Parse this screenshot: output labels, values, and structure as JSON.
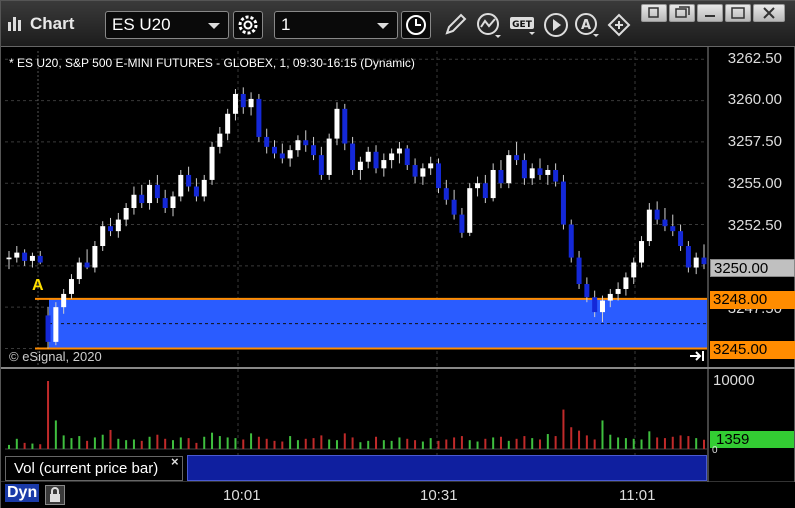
{
  "toolbar": {
    "app_title": "Chart",
    "symbol": "ES U20",
    "interval": "1",
    "icons": [
      "settings-gear-icon",
      "clock-icon",
      "pencil-icon",
      "indicator-icon",
      "get-icon",
      "play-icon",
      "auto-icon",
      "share-icon"
    ]
  },
  "chart": {
    "title": "* ES U20, S&P 500 E-MINI FUTURES - GLOBEX, 1, 09:30-16:15 (Dynamic)",
    "copyright": "© eSignal, 2020",
    "marker": "A",
    "price_axis": [
      "3262.50",
      "3260.00",
      "3257.50",
      "3255.00",
      "3252.50",
      "3250.00",
      "3247.50",
      "3245.00"
    ],
    "last_price": "3250.00",
    "zone_upper": "3248.00",
    "zone_lower": "3245.00",
    "colors": {
      "up": "#ffffff",
      "down": "#1428d8",
      "zone": "#2a5cff",
      "zone_border": "#ff8c00"
    }
  },
  "volume": {
    "label": "Vol (current price bar)",
    "max_label": "10000",
    "current": "1359",
    "zero": "0"
  },
  "time_axis": [
    "10:01",
    "10:31",
    "11:01"
  ],
  "bottom": {
    "dyn": "Dyn"
  },
  "chart_data": {
    "type": "candlestick",
    "title": "* ES U20, S&P 500 E-MINI FUTURES - GLOBEX, 1, 09:30-16:15 (Dynamic)",
    "ylim": [
      3244,
      3263
    ],
    "yticks": [
      3262.5,
      3260.0,
      3257.5,
      3255.0,
      3252.5,
      3250.0,
      3247.5,
      3245.0
    ],
    "xticks": [
      "10:01",
      "10:31",
      "11:01"
    ],
    "zone": [
      3245.0,
      3248.0
    ],
    "candles": [
      [
        3250.4,
        3250.9,
        3249.8,
        3250.5
      ],
      [
        3250.5,
        3251.2,
        3250.2,
        3250.8
      ],
      [
        3250.8,
        3251.0,
        3250.0,
        3250.3
      ],
      [
        3250.3,
        3250.8,
        3249.9,
        3250.6
      ],
      [
        3250.6,
        3250.9,
        3250.1,
        3250.2
      ],
      [
        3247.0,
        3247.5,
        3245.0,
        3245.4
      ],
      [
        3245.4,
        3247.8,
        3245.2,
        3247.5
      ],
      [
        3247.5,
        3248.6,
        3247.1,
        3248.3
      ],
      [
        3248.3,
        3249.5,
        3248.0,
        3249.2
      ],
      [
        3249.2,
        3250.5,
        3248.9,
        3250.2
      ],
      [
        3250.2,
        3251.0,
        3249.8,
        3249.9
      ],
      [
        3249.9,
        3251.5,
        3249.6,
        3251.2
      ],
      [
        3251.2,
        3252.7,
        3250.9,
        3252.4
      ],
      [
        3252.4,
        3252.9,
        3251.8,
        3252.1
      ],
      [
        3252.1,
        3253.2,
        3251.7,
        3252.8
      ],
      [
        3252.8,
        3253.8,
        3252.4,
        3253.5
      ],
      [
        3253.5,
        3254.8,
        3253.1,
        3254.3
      ],
      [
        3254.3,
        3254.9,
        3253.5,
        3253.8
      ],
      [
        3253.8,
        3255.2,
        3253.4,
        3254.9
      ],
      [
        3254.9,
        3255.5,
        3253.8,
        3254.1
      ],
      [
        3254.1,
        3254.6,
        3253.2,
        3253.5
      ],
      [
        3253.5,
        3254.5,
        3253.0,
        3254.2
      ],
      [
        3254.2,
        3255.8,
        3253.9,
        3255.5
      ],
      [
        3255.5,
        3256.0,
        3254.5,
        3254.8
      ],
      [
        3254.8,
        3255.3,
        3253.9,
        3254.2
      ],
      [
        3254.2,
        3255.5,
        3253.9,
        3255.2
      ],
      [
        3255.2,
        3257.5,
        3254.9,
        3257.2
      ],
      [
        3257.2,
        3258.4,
        3256.8,
        3258.0
      ],
      [
        3258.0,
        3259.5,
        3257.6,
        3259.2
      ],
      [
        3259.2,
        3260.7,
        3258.8,
        3260.4
      ],
      [
        3260.4,
        3260.8,
        3259.2,
        3259.6
      ],
      [
        3259.6,
        3260.5,
        3259.1,
        3260.1
      ],
      [
        3260.1,
        3260.4,
        3257.5,
        3257.8
      ],
      [
        3257.8,
        3258.3,
        3256.8,
        3257.2
      ],
      [
        3257.2,
        3257.6,
        3256.5,
        3256.8
      ],
      [
        3256.8,
        3257.4,
        3256.2,
        3256.5
      ],
      [
        3256.5,
        3257.3,
        3256.0,
        3257.0
      ],
      [
        3257.0,
        3257.9,
        3256.6,
        3257.6
      ],
      [
        3257.6,
        3258.2,
        3256.9,
        3257.3
      ],
      [
        3257.3,
        3257.8,
        3256.4,
        3256.7
      ],
      [
        3256.7,
        3257.2,
        3255.2,
        3255.5
      ],
      [
        3255.5,
        3258.0,
        3255.2,
        3257.7
      ],
      [
        3257.7,
        3259.9,
        3257.3,
        3259.5
      ],
      [
        3259.5,
        3259.8,
        3257.0,
        3257.4
      ],
      [
        3257.4,
        3257.8,
        3255.5,
        3255.8
      ],
      [
        3255.8,
        3256.6,
        3255.2,
        3256.3
      ],
      [
        3256.3,
        3257.2,
        3255.9,
        3256.9
      ],
      [
        3256.9,
        3257.3,
        3255.6,
        3255.9
      ],
      [
        3255.9,
        3256.8,
        3255.4,
        3256.4
      ],
      [
        3256.4,
        3257.1,
        3255.9,
        3256.8
      ],
      [
        3256.8,
        3257.5,
        3256.2,
        3257.1
      ],
      [
        3257.1,
        3257.3,
        3255.8,
        3256.1
      ],
      [
        3256.1,
        3256.5,
        3255.0,
        3255.4
      ],
      [
        3255.4,
        3256.2,
        3254.9,
        3255.9
      ],
      [
        3255.9,
        3256.6,
        3255.5,
        3256.2
      ],
      [
        3256.2,
        3256.5,
        3254.4,
        3254.7
      ],
      [
        3254.7,
        3255.2,
        3253.7,
        3254.0
      ],
      [
        3254.0,
        3254.6,
        3252.8,
        3253.1
      ],
      [
        3253.1,
        3253.5,
        3251.7,
        3252.0
      ],
      [
        3252.0,
        3255.0,
        3251.8,
        3254.7
      ],
      [
        3254.7,
        3255.4,
        3254.2,
        3255.0
      ],
      [
        3255.0,
        3255.5,
        3253.8,
        3254.1
      ],
      [
        3254.1,
        3256.2,
        3253.9,
        3255.8
      ],
      [
        3255.8,
        3256.4,
        3254.7,
        3255.0
      ],
      [
        3255.0,
        3257.0,
        3254.7,
        3256.7
      ],
      [
        3256.7,
        3257.5,
        3256.1,
        3256.4
      ],
      [
        3256.4,
        3256.8,
        3254.9,
        3255.3
      ],
      [
        3255.3,
        3256.2,
        3254.9,
        3255.9
      ],
      [
        3255.9,
        3256.5,
        3255.2,
        3255.5
      ],
      [
        3255.5,
        3256.1,
        3254.9,
        3255.8
      ],
      [
        3255.8,
        3256.2,
        3254.8,
        3255.1
      ],
      [
        3255.1,
        3255.5,
        3252.2,
        3252.5
      ],
      [
        3252.5,
        3252.8,
        3250.2,
        3250.5
      ],
      [
        3250.5,
        3250.9,
        3248.6,
        3248.9
      ],
      [
        3248.9,
        3249.3,
        3247.8,
        3248.1
      ],
      [
        3248.1,
        3248.5,
        3246.9,
        3247.2
      ],
      [
        3247.2,
        3248.2,
        3246.6,
        3247.9
      ],
      [
        3247.9,
        3248.6,
        3247.5,
        3248.3
      ],
      [
        3248.3,
        3249.0,
        3247.9,
        3248.6
      ],
      [
        3248.6,
        3249.6,
        3248.2,
        3249.3
      ],
      [
        3249.3,
        3250.5,
        3248.9,
        3250.2
      ],
      [
        3250.2,
        3251.8,
        3249.9,
        3251.5
      ],
      [
        3251.5,
        3253.8,
        3251.2,
        3253.4
      ],
      [
        3253.4,
        3253.9,
        3252.5,
        3252.8
      ],
      [
        3252.8,
        3253.5,
        3252.1,
        3252.4
      ],
      [
        3252.4,
        3253.1,
        3251.8,
        3252.1
      ],
      [
        3252.1,
        3252.5,
        3250.9,
        3251.2
      ],
      [
        3251.2,
        3251.5,
        3249.6,
        3249.9
      ],
      [
        3249.9,
        3250.8,
        3249.5,
        3250.5
      ],
      [
        3250.5,
        3251.3,
        3249.8,
        3250.1
      ]
    ],
    "volume": [
      600,
      1500,
      900,
      800,
      700,
      10000,
      4200,
      2000,
      1600,
      1900,
      1200,
      1700,
      2100,
      2800,
      1500,
      1300,
      1400,
      1200,
      1800,
      2100,
      1500,
      1300,
      1700,
      1600,
      900,
      1800,
      2400,
      1900,
      1700,
      1600,
      1400,
      2300,
      1800,
      1500,
      1200,
      1100,
      1900,
      1300,
      1500,
      1600,
      2000,
      1400,
      1300,
      2300,
      1700,
      1000,
      1200,
      1800,
      1300,
      1200,
      1700,
      1500,
      1300,
      1100,
      1600,
      1200,
      1400,
      1700,
      1900,
      1300,
      1100,
      1500,
      1700,
      1800,
      1200,
      1500,
      1900,
      1600,
      1400,
      2200,
      1900,
      5800,
      3200,
      2700,
      2000,
      1400,
      4200,
      2100,
      1700,
      1600,
      1500,
      1400,
      2600,
      1700,
      1600,
      1800,
      2000,
      1900,
      1600,
      1359
    ]
  }
}
